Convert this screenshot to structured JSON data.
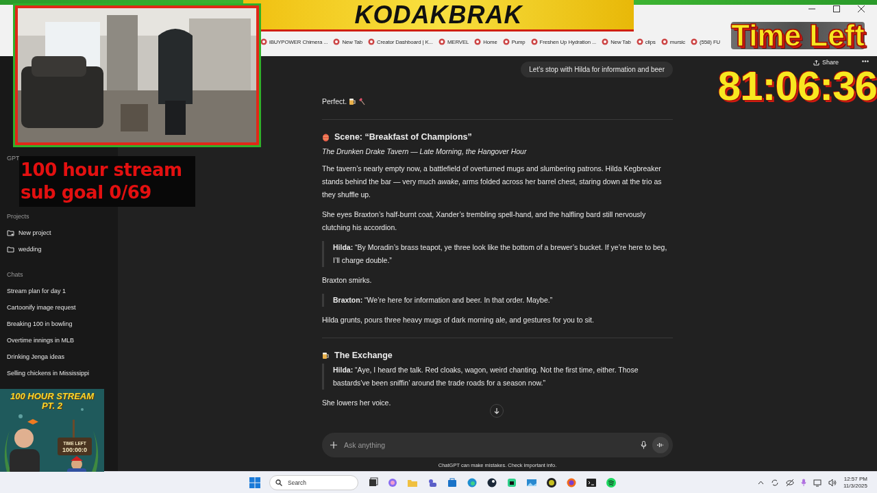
{
  "browser": {
    "bookmarks": [
      {
        "label": "iBUYPOWER Chimera ..."
      },
      {
        "label": "New Tab"
      },
      {
        "label": "Creator Dashboard | K..."
      },
      {
        "label": "MERVEL"
      },
      {
        "label": "Home"
      },
      {
        "label": "Pump"
      },
      {
        "label": "Freshen Up Hydration ..."
      },
      {
        "label": "New Tab"
      },
      {
        "label": "clips"
      },
      {
        "label": "mursic"
      },
      {
        "label": "(558) FU"
      }
    ]
  },
  "sidebar": {
    "gpts_title": "GPT",
    "projects": {
      "title": "Projects",
      "items": [
        {
          "label": "New project",
          "kind": "new"
        },
        {
          "label": "wedding",
          "kind": "folder"
        }
      ]
    },
    "chats": {
      "title": "Chats",
      "items": [
        {
          "label": "Stream plan for day 1"
        },
        {
          "label": "Cartoonify image request"
        },
        {
          "label": "Breaking 100 in bowling"
        },
        {
          "label": "Overtime innings in MLB"
        },
        {
          "label": "Drinking Jenga ideas"
        },
        {
          "label": "Selling chickens in Mississippi"
        }
      ]
    }
  },
  "header": {
    "share": "Share"
  },
  "conversation": [
    {
      "kind": "user",
      "text": "Let’s stop with Hilda for information and beer"
    },
    {
      "kind": "reaction",
      "text": "Perfect."
    },
    {
      "kind": "rule"
    },
    {
      "kind": "heading",
      "text": "Scene: “Breakfast of Champions”"
    },
    {
      "kind": "subtitle",
      "text": "The Drunken Drake Tavern — Late Morning, the Hangover Hour"
    },
    {
      "kind": "paragraph",
      "text": "The tavern’s nearly empty now, a battlefield of overturned mugs and slumbering patrons. Hilda Kegbreaker stands behind the bar — very much *awake*, arms folded across her barrel chest, staring down at the trio as they shuffle up."
    },
    {
      "kind": "paragraph",
      "text": "She eyes Braxton’s half-burnt coat, Xander’s trembling spell-hand, and the halfling bard still nervously clutching his accordion."
    },
    {
      "kind": "quote",
      "text": "**Hilda:** “By Moradin’s brass teapot, ye three look like the bottom of a brewer’s bucket. If ye’re here to beg, I’ll charge double.”"
    },
    {
      "kind": "paragraph",
      "text": "Braxton smirks."
    },
    {
      "kind": "quote",
      "text": "**Braxton:** “We’re here for information and beer. In that order. Maybe.”"
    },
    {
      "kind": "paragraph",
      "text": "Hilda grunts, pours three heavy mugs of dark morning ale, and gestures for you to sit."
    },
    {
      "kind": "rule"
    },
    {
      "kind": "heading",
      "text": "The Exchange"
    },
    {
      "kind": "quote",
      "text": "**Hilda:** “Aye, I heard the talk. Red cloaks, wagon, weird chanting. Not the first time, either. Those bastards’ve been sniffin’ around the trade roads for a season now.”"
    },
    {
      "kind": "paragraph",
      "text": "She lowers her voice."
    }
  ],
  "composer": {
    "placeholder": "Ask anything",
    "disclaimer": "ChatGPT can make mistakes. Check important info."
  },
  "taskbar": {
    "search": "Search",
    "time": "12:57 PM",
    "date": "11/3/2025"
  },
  "overlay": {
    "banner_title": "KODAKBRAK",
    "timer_label": "Time Left",
    "timer": "81:06:36",
    "goal_lines": [
      "100 hour stream",
      "sub goal 0/69"
    ],
    "poster": {
      "title": "100 HOUR STREAM",
      "subtitle": "PT. 2",
      "sign_label": "TIME LEFT",
      "sign_time": "100:00:0"
    }
  }
}
